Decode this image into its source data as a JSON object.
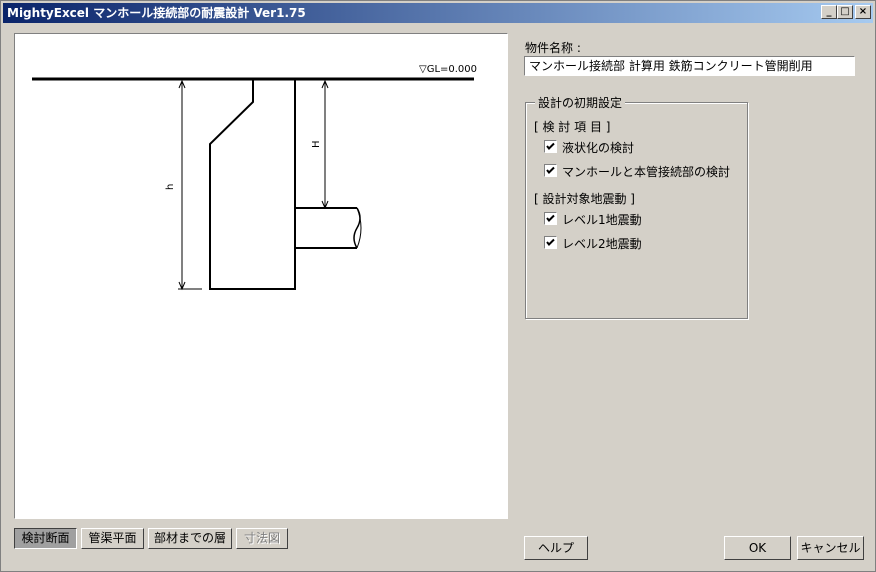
{
  "window": {
    "title": "MightyExcel マンホール接続部の耐震設計 Ver1.75",
    "controls": {
      "minimize": "_",
      "maximize": "□",
      "close": "×"
    }
  },
  "drawing": {
    "gl_label": "▽GL=0.000",
    "dim_h_label": "h",
    "dim_H_label": "H"
  },
  "tabs": [
    {
      "label": "検討断面",
      "state": "active"
    },
    {
      "label": "管渠平面",
      "state": "normal"
    },
    {
      "label": "部材までの層",
      "state": "normal"
    },
    {
      "label": "寸法図",
      "state": "disabled"
    }
  ],
  "form": {
    "project_label": "物件名称 :",
    "project_value": "マンホール接続部 計算用 鉄筋コンクリート管開削用",
    "group_title": "設計の初期設定",
    "section1_title": "[ 検 討 項 目 ]",
    "items1": [
      {
        "label": "液状化の検討",
        "checked": true
      },
      {
        "label": "マンホールと本管接続部の検討",
        "checked": true
      }
    ],
    "section2_title": "[ 設計対象地震動 ]",
    "items2": [
      {
        "label": "レベル1地震動",
        "checked": true
      },
      {
        "label": "レベル2地震動",
        "checked": true
      }
    ]
  },
  "buttons": {
    "help": "ヘルプ",
    "ok": "OK",
    "cancel": "キャンセル"
  }
}
